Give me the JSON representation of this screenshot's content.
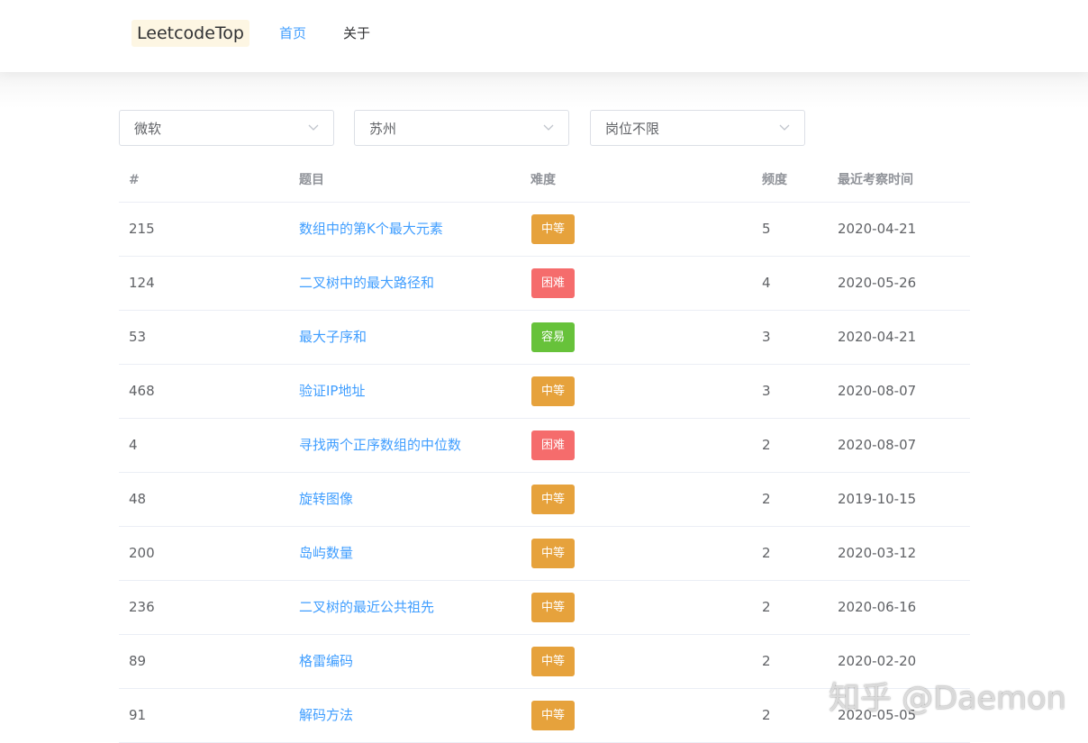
{
  "header": {
    "logo": "LeetcodeTop",
    "nav": [
      {
        "label": "首页",
        "active": true
      },
      {
        "label": "关于",
        "active": false
      }
    ]
  },
  "filters": {
    "company": "微软",
    "city": "苏州",
    "position": "岗位不限"
  },
  "table": {
    "headers": {
      "id": "#",
      "title": "题目",
      "difficulty": "难度",
      "frequency": "频度",
      "last_seen": "最近考察时间"
    },
    "rows": [
      {
        "id": "215",
        "title": "数组中的第K个最大元素",
        "difficulty": "中等",
        "frequency": "5",
        "last_seen": "2020-04-21"
      },
      {
        "id": "124",
        "title": "二叉树中的最大路径和",
        "difficulty": "困难",
        "frequency": "4",
        "last_seen": "2020-05-26"
      },
      {
        "id": "53",
        "title": "最大子序和",
        "difficulty": "容易",
        "frequency": "3",
        "last_seen": "2020-04-21"
      },
      {
        "id": "468",
        "title": "验证IP地址",
        "difficulty": "中等",
        "frequency": "3",
        "last_seen": "2020-08-07"
      },
      {
        "id": "4",
        "title": "寻找两个正序数组的中位数",
        "difficulty": "困难",
        "frequency": "2",
        "last_seen": "2020-08-07"
      },
      {
        "id": "48",
        "title": "旋转图像",
        "difficulty": "中等",
        "frequency": "2",
        "last_seen": "2019-10-15"
      },
      {
        "id": "200",
        "title": "岛屿数量",
        "difficulty": "中等",
        "frequency": "2",
        "last_seen": "2020-03-12"
      },
      {
        "id": "236",
        "title": "二叉树的最近公共祖先",
        "difficulty": "中等",
        "frequency": "2",
        "last_seen": "2020-06-16"
      },
      {
        "id": "89",
        "title": "格雷编码",
        "difficulty": "中等",
        "frequency": "2",
        "last_seen": "2020-02-20"
      },
      {
        "id": "91",
        "title": "解码方法",
        "difficulty": "中等",
        "frequency": "2",
        "last_seen": "2020-05-05"
      }
    ]
  },
  "difficulty_colors": {
    "中等": "#e6a23c",
    "困难": "#f56c6c",
    "容易": "#67c23a"
  },
  "watermark": "知乎 @Daemon"
}
